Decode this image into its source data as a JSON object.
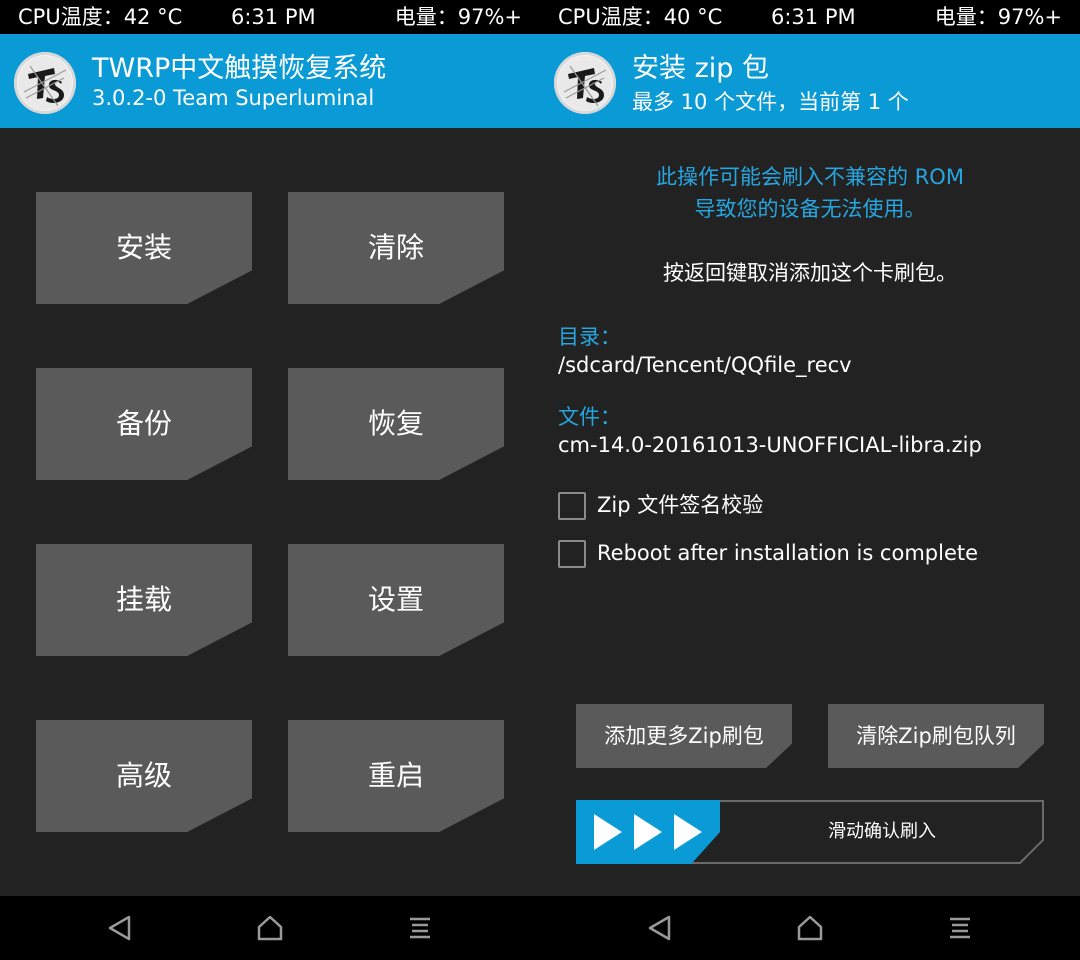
{
  "left": {
    "status": {
      "cpu": "CPU温度：42 °C",
      "time": "6:31 PM",
      "battery": "电量：97%+"
    },
    "header": {
      "title": "TWRP中文触摸恢复系统",
      "subtitle": "3.0.2-0 Team Superluminal"
    },
    "menu": {
      "install": "安装",
      "wipe": "清除",
      "backup": "备份",
      "restore": "恢复",
      "mount": "挂载",
      "settings": "设置",
      "advanced": "高级",
      "reboot": "重启"
    },
    "nav": {
      "back_icon": "triangle-back-icon",
      "home_icon": "home-icon",
      "menu_icon": "lines-menu-icon"
    }
  },
  "right": {
    "status": {
      "cpu": "CPU温度：40 °C",
      "time": "6:31 PM",
      "battery": "电量：97%+"
    },
    "header": {
      "title": "安装 zip 包",
      "subtitle": "最多 10 个文件，当前第 1 个"
    },
    "warning_line1": "此操作可能会刷入不兼容的 ROM",
    "warning_line2": "导致您的设备无法使用。",
    "note": "按返回键取消添加这个卡刷包。",
    "dir_label": "目录：",
    "dir_value": "/sdcard/Tencent/QQfile_recv",
    "file_label": "文件：",
    "file_value": "cm-14.0-20161013-UNOFFICIAL-libra.zip",
    "options": [
      {
        "label": "Zip 文件签名校验",
        "checked": false
      },
      {
        "label": "Reboot after installation is complete",
        "checked": false
      }
    ],
    "buttons": {
      "add_more": "添加更多Zip刷包",
      "clear_queue": "清除Zip刷包队列"
    },
    "slider": {
      "label": "滑动确认刷入"
    },
    "nav": {
      "back_icon": "triangle-back-icon",
      "home_icon": "home-icon",
      "menu_icon": "lines-menu-icon"
    }
  },
  "colors": {
    "accent": "#0a9ad6",
    "background": "#222222",
    "tile": "#5a5a5a",
    "warning_text": "#26a6e0"
  }
}
